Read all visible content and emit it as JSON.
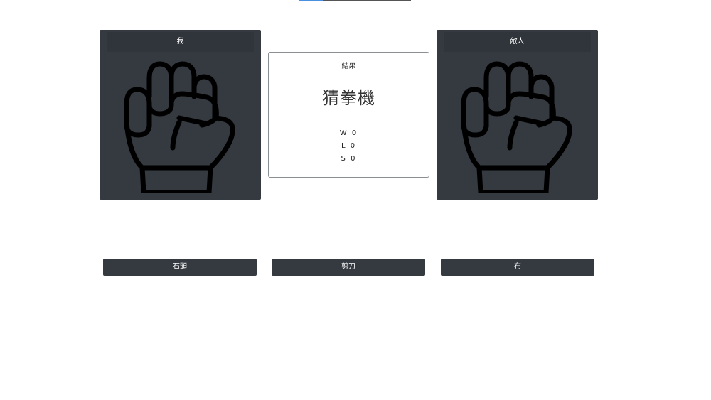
{
  "progress": {
    "fraction": 0.21
  },
  "player": {
    "title": "我",
    "hand_icon": "fist-icon"
  },
  "enemy": {
    "title": "敵人",
    "hand_icon": "fist-icon"
  },
  "result": {
    "label": "結果",
    "title": "猜拳機",
    "wins": "W 0",
    "losses": "L 0",
    "draws": "S 0"
  },
  "buttons": {
    "rock": "石頭",
    "scissors": "剪刀",
    "paper": "布"
  },
  "colors": {
    "panel": "#353a40",
    "accent": "#4a90e2"
  }
}
